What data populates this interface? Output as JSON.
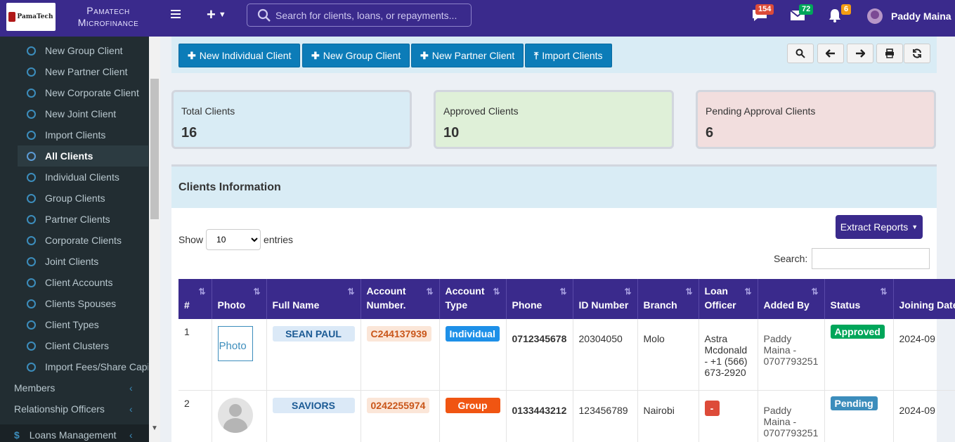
{
  "brand": {
    "logo_text": "PamaTech",
    "name_line1": "Pamatech",
    "name_line2": "Microfinance"
  },
  "topbar": {
    "search_placeholder": "Search for clients, loans, or repayments...",
    "messages_badge": "154",
    "mail_badge": "72",
    "notifications_badge": "6",
    "user_name": "Paddy Maina"
  },
  "sidebar": {
    "items": [
      {
        "label": "New Group Client"
      },
      {
        "label": "New Partner Client"
      },
      {
        "label": "New Corporate Client"
      },
      {
        "label": "New Joint Client"
      },
      {
        "label": "Import Clients"
      },
      {
        "label": "All Clients"
      },
      {
        "label": "Individual Clients"
      },
      {
        "label": "Group Clients"
      },
      {
        "label": "Partner Clients"
      },
      {
        "label": "Corporate Clients"
      },
      {
        "label": "Joint Clients"
      },
      {
        "label": "Client Accounts"
      },
      {
        "label": "Clients Spouses"
      },
      {
        "label": "Client Types"
      },
      {
        "label": "Client Clusters"
      },
      {
        "label": "Import Fees/Share Capi"
      }
    ],
    "sections": [
      {
        "label": "Members"
      },
      {
        "label": "Relationship Officers"
      },
      {
        "label": "Loans Management"
      }
    ]
  },
  "actions": {
    "new_individual": "New Individual Client",
    "new_group": "New Group Client",
    "new_partner": "New Partner Client",
    "import": "Import Clients"
  },
  "stats": {
    "total_label": "Total Clients",
    "total_value": "16",
    "approved_label": "Approved Clients",
    "approved_value": "10",
    "pending_label": "Pending Approval Clients",
    "pending_value": "6"
  },
  "panel": {
    "title": "Clients Information",
    "extract_label": "Extract Reports",
    "show_label": "Show",
    "entries_label": "entries",
    "entries_value": "10",
    "search_label": "Search:"
  },
  "table": {
    "headers": [
      "#",
      "Photo",
      "Full Name",
      "Account Number.",
      "Account Type",
      "Phone",
      "ID Number",
      "Branch",
      "Loan Officer",
      "Added By",
      "Status",
      "Joining Date"
    ],
    "rows": [
      {
        "num": "1",
        "photo_alt": "Photo",
        "name": "SEAN PAUL",
        "account": "C244137939",
        "type": "Individual",
        "type_color": "#1e90e8",
        "phone": "0712345678",
        "id_number": "20304050",
        "branch": "Molo",
        "officer": "Astra Mcdonald - +1 (566) 673-2920",
        "added_by": "Paddy Maina - 0707793251",
        "status": "Approved",
        "status_color": "#00a65a",
        "joining": "2024-09"
      },
      {
        "num": "2",
        "name": "SAVIORS",
        "account": "0242255974",
        "type": "Group",
        "type_color": "#f05512",
        "phone": "0133443212",
        "id_number": "123456789",
        "branch": "Nairobi",
        "officer": "-",
        "added_by": "Paddy Maina - 0707793251",
        "status": "Pending",
        "status_color": "#3c8dbc",
        "joining": "2024-09"
      }
    ]
  }
}
